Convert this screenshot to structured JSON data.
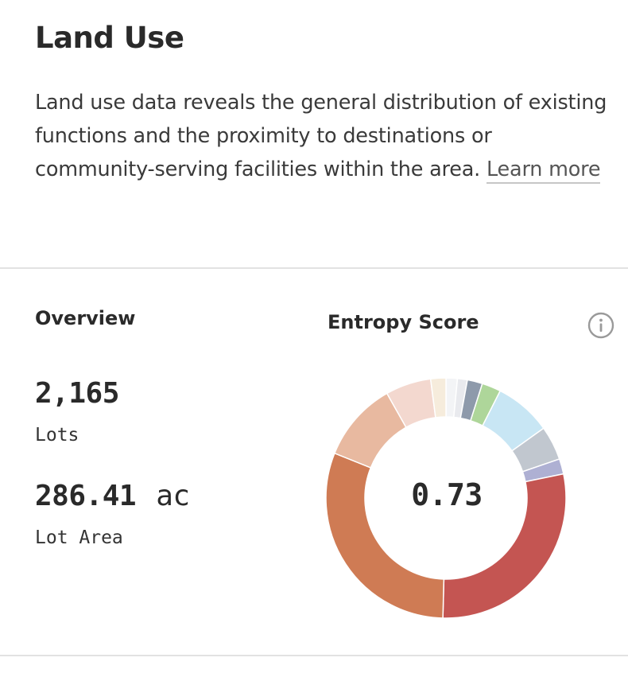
{
  "section": {
    "title": "Land Use",
    "description": "Land use data reveals the general distribution of existing functions and the proximity to destinations or community-serving facilities within the area.",
    "learn_more_label": "Learn more"
  },
  "overview": {
    "heading": "Overview",
    "lots_value": "2,165",
    "lots_label": "Lots",
    "area_value": "286.41",
    "area_unit": "ac",
    "area_label": "Lot Area"
  },
  "entropy": {
    "heading": "Entropy Score",
    "score": "0.73",
    "info_icon": "info-icon"
  },
  "chart_data": {
    "type": "pie",
    "donut": true,
    "title": "Entropy Score",
    "center_label": "0.73",
    "slices": [
      {
        "value": 1.5,
        "color": "#f3f4f6"
      },
      {
        "value": 1.3,
        "color": "#e9eaee"
      },
      {
        "value": 2.0,
        "color": "#8e9aab"
      },
      {
        "value": 2.5,
        "color": "#aed69a"
      },
      {
        "value": 7.5,
        "color": "#c8e6f4"
      },
      {
        "value": 4.5,
        "color": "#c1c7cf"
      },
      {
        "value": 2.0,
        "color": "#aeb0d3"
      },
      {
        "value": 28.0,
        "color": "#c45552"
      },
      {
        "value": 30.0,
        "color": "#cf7b54"
      },
      {
        "value": 10.5,
        "color": "#e8b9a0"
      },
      {
        "value": 6.0,
        "color": "#f3d8cf"
      },
      {
        "value": 2.0,
        "color": "#f6ecdc"
      }
    ]
  }
}
